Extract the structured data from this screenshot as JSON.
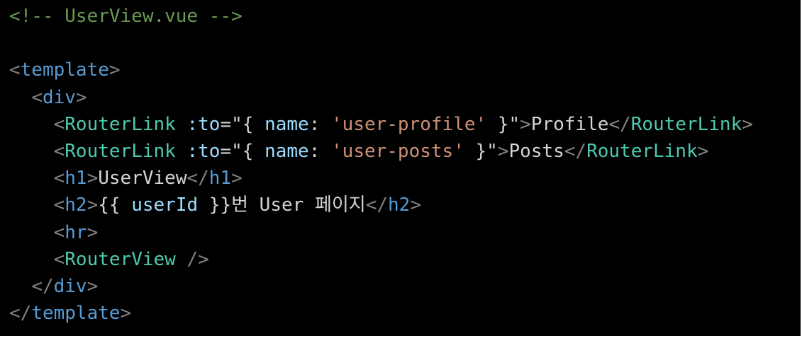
{
  "editor": {
    "colors": {
      "background": "#000000",
      "comment": "#6a9955",
      "punctuation": "#808080",
      "tag": "#569cd6",
      "component": "#4ec9b0",
      "attribute": "#9cdcfe",
      "string": "#ce9178",
      "text": "#d4d4d4"
    },
    "lines": [
      [
        {
          "t": "<!-- UserView.vue -->",
          "c": "comment"
        }
      ],
      [],
      [
        {
          "t": "<",
          "c": "punc"
        },
        {
          "t": "template",
          "c": "tag"
        },
        {
          "t": ">",
          "c": "punc"
        }
      ],
      [
        {
          "t": "  ",
          "c": "txt"
        },
        {
          "t": "<",
          "c": "punc"
        },
        {
          "t": "div",
          "c": "tag"
        },
        {
          "t": ">",
          "c": "punc"
        }
      ],
      [
        {
          "t": "    ",
          "c": "txt"
        },
        {
          "t": "<",
          "c": "punc"
        },
        {
          "t": "RouterLink",
          "c": "comp"
        },
        {
          "t": " ",
          "c": "txt"
        },
        {
          "t": ":to",
          "c": "attr"
        },
        {
          "t": "=\"{ ",
          "c": "txt"
        },
        {
          "t": "name",
          "c": "attr"
        },
        {
          "t": ": ",
          "c": "txt"
        },
        {
          "t": "'user-profile'",
          "c": "str"
        },
        {
          "t": " }\"",
          "c": "txt"
        },
        {
          "t": ">",
          "c": "punc"
        },
        {
          "t": "Profile",
          "c": "txt"
        },
        {
          "t": "</",
          "c": "punc"
        },
        {
          "t": "RouterLink",
          "c": "comp"
        },
        {
          "t": ">",
          "c": "punc"
        }
      ],
      [
        {
          "t": "    ",
          "c": "txt"
        },
        {
          "t": "<",
          "c": "punc"
        },
        {
          "t": "RouterLink",
          "c": "comp"
        },
        {
          "t": " ",
          "c": "txt"
        },
        {
          "t": ":to",
          "c": "attr"
        },
        {
          "t": "=\"{ ",
          "c": "txt"
        },
        {
          "t": "name",
          "c": "attr"
        },
        {
          "t": ": ",
          "c": "txt"
        },
        {
          "t": "'user-posts'",
          "c": "str"
        },
        {
          "t": " }\"",
          "c": "txt"
        },
        {
          "t": ">",
          "c": "punc"
        },
        {
          "t": "Posts",
          "c": "txt"
        },
        {
          "t": "</",
          "c": "punc"
        },
        {
          "t": "RouterLink",
          "c": "comp"
        },
        {
          "t": ">",
          "c": "punc"
        }
      ],
      [
        {
          "t": "    ",
          "c": "txt"
        },
        {
          "t": "<",
          "c": "punc"
        },
        {
          "t": "h1",
          "c": "tag"
        },
        {
          "t": ">",
          "c": "punc"
        },
        {
          "t": "UserView",
          "c": "txt"
        },
        {
          "t": "</",
          "c": "punc"
        },
        {
          "t": "h1",
          "c": "tag"
        },
        {
          "t": ">",
          "c": "punc"
        }
      ],
      [
        {
          "t": "    ",
          "c": "txt"
        },
        {
          "t": "<",
          "c": "punc"
        },
        {
          "t": "h2",
          "c": "tag"
        },
        {
          "t": ">",
          "c": "punc"
        },
        {
          "t": "{{ ",
          "c": "txt"
        },
        {
          "t": "userId",
          "c": "attr"
        },
        {
          "t": " }}번 User 페이지",
          "c": "txt"
        },
        {
          "t": "</",
          "c": "punc"
        },
        {
          "t": "h2",
          "c": "tag"
        },
        {
          "t": ">",
          "c": "punc"
        }
      ],
      [
        {
          "t": "    ",
          "c": "txt"
        },
        {
          "t": "<",
          "c": "punc"
        },
        {
          "t": "hr",
          "c": "tag"
        },
        {
          "t": ">",
          "c": "punc"
        }
      ],
      [
        {
          "t": "    ",
          "c": "txt"
        },
        {
          "t": "<",
          "c": "punc"
        },
        {
          "t": "RouterView",
          "c": "comp"
        },
        {
          "t": " />",
          "c": "punc"
        }
      ],
      [
        {
          "t": "  ",
          "c": "txt"
        },
        {
          "t": "</",
          "c": "punc"
        },
        {
          "t": "div",
          "c": "tag"
        },
        {
          "t": ">",
          "c": "punc"
        }
      ],
      [
        {
          "t": "</",
          "c": "punc"
        },
        {
          "t": "template",
          "c": "tag"
        },
        {
          "t": ">",
          "c": "punc"
        }
      ]
    ]
  }
}
